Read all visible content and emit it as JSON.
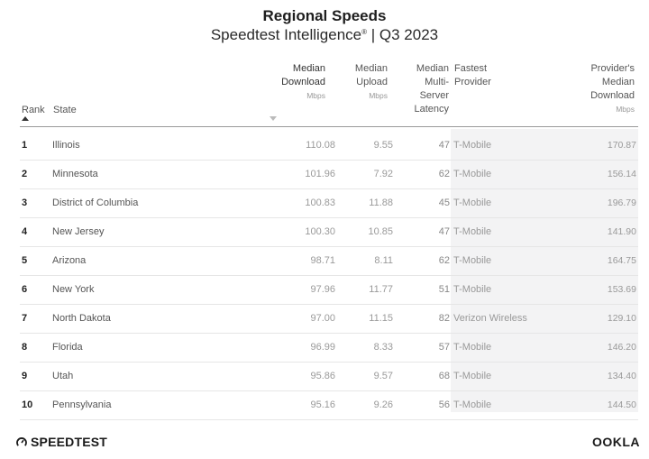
{
  "header": {
    "title": "Regional Speeds",
    "subtitle_main": "Speedtest Intelligence",
    "subtitle_mark": "®",
    "subtitle_period": " | Q3 2023"
  },
  "columns": {
    "rank": "Rank",
    "state": "State",
    "median_download": [
      "Median",
      "Download"
    ],
    "median_download_unit": "Mbps",
    "median_upload": [
      "Median",
      "Upload"
    ],
    "median_upload_unit": "Mbps",
    "latency": [
      "Median",
      "Multi-",
      "Server",
      "Latency"
    ],
    "fastest_provider": [
      "Fastest",
      "Provider"
    ],
    "provider_download": [
      "Provider's",
      "Median",
      "Download"
    ],
    "provider_download_unit": "Mbps"
  },
  "rows": [
    {
      "rank": "1",
      "state": "Illinois",
      "download": "110.08",
      "upload": "9.55",
      "latency": "47",
      "provider": "T-Mobile",
      "provider_download": "170.87"
    },
    {
      "rank": "2",
      "state": "Minnesota",
      "download": "101.96",
      "upload": "7.92",
      "latency": "62",
      "provider": "T-Mobile",
      "provider_download": "156.14"
    },
    {
      "rank": "3",
      "state": "District of Columbia",
      "download": "100.83",
      "upload": "11.88",
      "latency": "45",
      "provider": "T-Mobile",
      "provider_download": "196.79"
    },
    {
      "rank": "4",
      "state": "New Jersey",
      "download": "100.30",
      "upload": "10.85",
      "latency": "47",
      "provider": "T-Mobile",
      "provider_download": "141.90"
    },
    {
      "rank": "5",
      "state": "Arizona",
      "download": "98.71",
      "upload": "8.11",
      "latency": "62",
      "provider": "T-Mobile",
      "provider_download": "164.75"
    },
    {
      "rank": "6",
      "state": "New York",
      "download": "97.96",
      "upload": "11.77",
      "latency": "51",
      "provider": "T-Mobile",
      "provider_download": "153.69"
    },
    {
      "rank": "7",
      "state": "North Dakota",
      "download": "97.00",
      "upload": "11.15",
      "latency": "82",
      "provider": "Verizon Wireless",
      "provider_download": "129.10"
    },
    {
      "rank": "8",
      "state": "Florida",
      "download": "96.99",
      "upload": "8.33",
      "latency": "57",
      "provider": "T-Mobile",
      "provider_download": "146.20"
    },
    {
      "rank": "9",
      "state": "Utah",
      "download": "95.86",
      "upload": "9.57",
      "latency": "68",
      "provider": "T-Mobile",
      "provider_download": "134.40"
    },
    {
      "rank": "10",
      "state": "Pennsylvania",
      "download": "95.16",
      "upload": "9.26",
      "latency": "56",
      "provider": "T-Mobile",
      "provider_download": "144.50"
    }
  ],
  "footer": {
    "left_logo": "SPEEDTEST",
    "right_logo": "OOKLA"
  },
  "icons": {
    "sort_asc": "sort-ascending-icon",
    "sort_desc": "sort-descending-icon",
    "gauge": "speedometer-icon"
  },
  "colors": {
    "shade": "#f3f3f4",
    "header_rule": "#9a9a9a",
    "row_rule": "#e6e6e6"
  }
}
